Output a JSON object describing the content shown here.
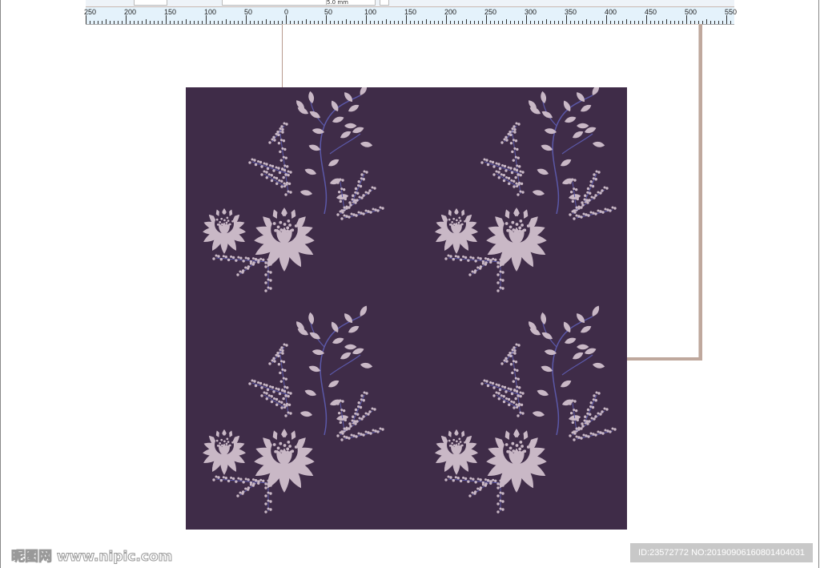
{
  "toolbar": {
    "nudge_value": "5.0 mm"
  },
  "ruler": {
    "labels": [
      "250",
      "200",
      "150",
      "100",
      "50",
      "0",
      "50",
      "100",
      "150",
      "200",
      "250",
      "300",
      "350",
      "400",
      "450",
      "500",
      "550"
    ]
  },
  "canvas": {
    "pattern_background": "#3f2c48",
    "flower_color": "#c9b8c6",
    "stem_color": "#5b58a8",
    "motif_repeat": "2x2"
  },
  "watermark": {
    "site": "昵图网 www.nipic.com",
    "id_text": "ID:23572772 NO:20190906160801404031"
  }
}
